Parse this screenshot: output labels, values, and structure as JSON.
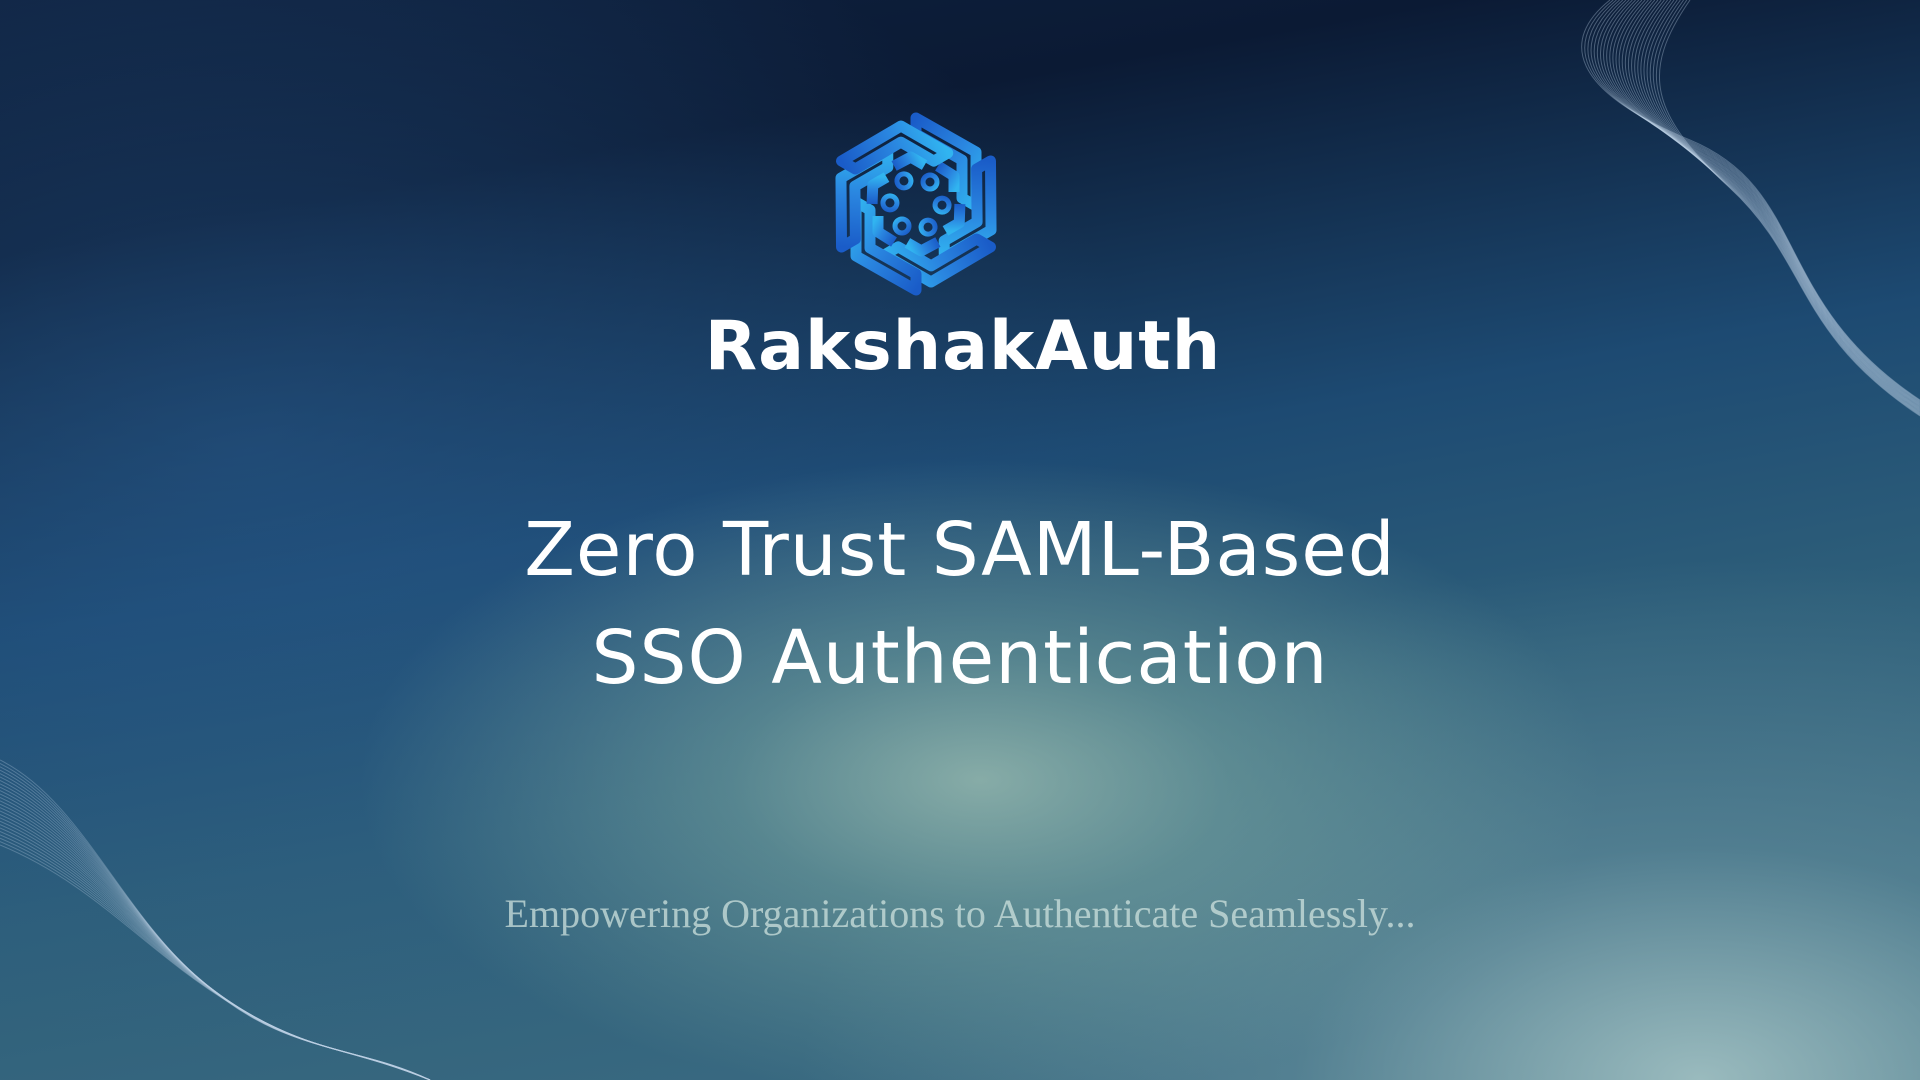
{
  "logo": {
    "icon": "hexagon-circuit-icon",
    "colors": {
      "light": "#2fa8ee",
      "dark": "#1a5cc8"
    }
  },
  "brand": {
    "name": "RakshakAuth"
  },
  "headline": {
    "line1": "Zero Trust SAML-Based",
    "line2": "SSO Authentication"
  },
  "tagline": {
    "text": "Empowering Organizations to Authenticate Seamlessly..."
  },
  "theme": {
    "background_dark": "#0b1a34",
    "background_mid": "#1d4a72",
    "background_light": "#9fbfba",
    "text_primary": "#ffffff"
  }
}
